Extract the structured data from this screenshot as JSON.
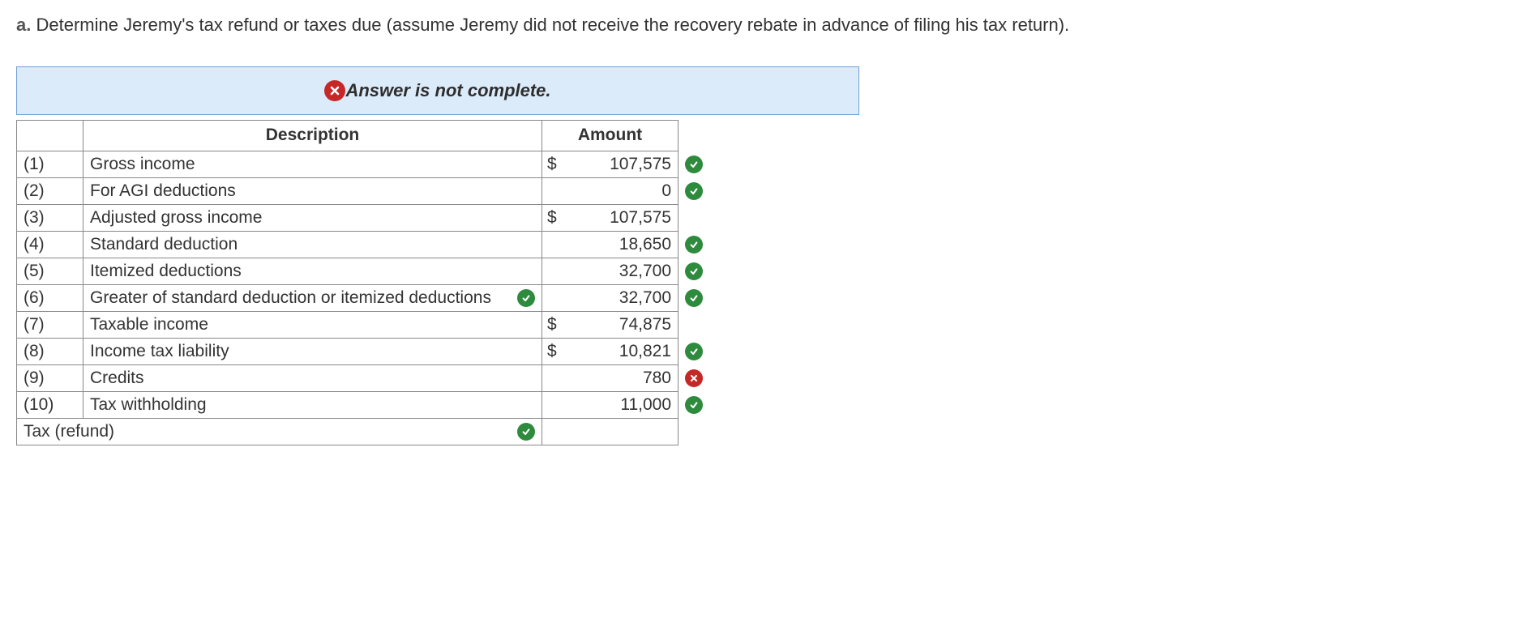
{
  "question": {
    "prefix": "a.",
    "text": "Determine Jeremy's tax refund or taxes due (assume Jeremy did not receive the recovery rebate in advance of filing his tax return)."
  },
  "banner": {
    "text": "Answer is not complete.",
    "icon": "error-circle"
  },
  "headers": {
    "description": "Description",
    "amount": "Amount"
  },
  "rows": [
    {
      "num": "(1)",
      "desc": "Gross income",
      "desc_mark": null,
      "dollar": "$",
      "amount": "107,575",
      "amt_class": "editable",
      "amt_mark": "ok"
    },
    {
      "num": "(2)",
      "desc": "For AGI deductions",
      "desc_mark": null,
      "dollar": "",
      "amount": "0",
      "amt_class": "editable",
      "amt_mark": "ok"
    },
    {
      "num": "(3)",
      "desc": "Adjusted gross income",
      "desc_mark": null,
      "dollar": "$",
      "amount": "107,575",
      "amt_class": "calculated",
      "amt_mark": null
    },
    {
      "num": "(4)",
      "desc": "Standard deduction",
      "desc_mark": null,
      "dollar": "",
      "amount": "18,650",
      "amt_class": "editable",
      "amt_mark": "ok"
    },
    {
      "num": "(5)",
      "desc": "Itemized deductions",
      "desc_mark": null,
      "dollar": "",
      "amount": "32,700",
      "amt_class": "editable",
      "amt_mark": "ok"
    },
    {
      "num": "(6)",
      "desc": "Greater of standard deduction or itemized deductions",
      "desc_mark": "ok",
      "dollar": "",
      "amount": "32,700",
      "amt_class": "editable",
      "amt_mark": "ok"
    },
    {
      "num": "(7)",
      "desc": "Taxable income",
      "desc_mark": null,
      "dollar": "$",
      "amount": "74,875",
      "amt_class": "calculated",
      "amt_mark": null
    },
    {
      "num": "(8)",
      "desc": "Income tax liability",
      "desc_mark": null,
      "dollar": "$",
      "amount": "10,821",
      "amt_class": "editable",
      "amt_mark": "ok"
    },
    {
      "num": "(9)",
      "desc": "Credits",
      "desc_mark": null,
      "dollar": "",
      "amount": "780",
      "amt_class": "wrong-bg",
      "amt_mark": "err"
    },
    {
      "num": "(10)",
      "desc": "Tax withholding",
      "desc_mark": null,
      "dollar": "",
      "amount": "11,000",
      "amt_class": "editable",
      "amt_mark": "ok"
    }
  ],
  "final_row": {
    "desc": "Tax (refund)",
    "desc_mark": "ok",
    "amount": ""
  }
}
